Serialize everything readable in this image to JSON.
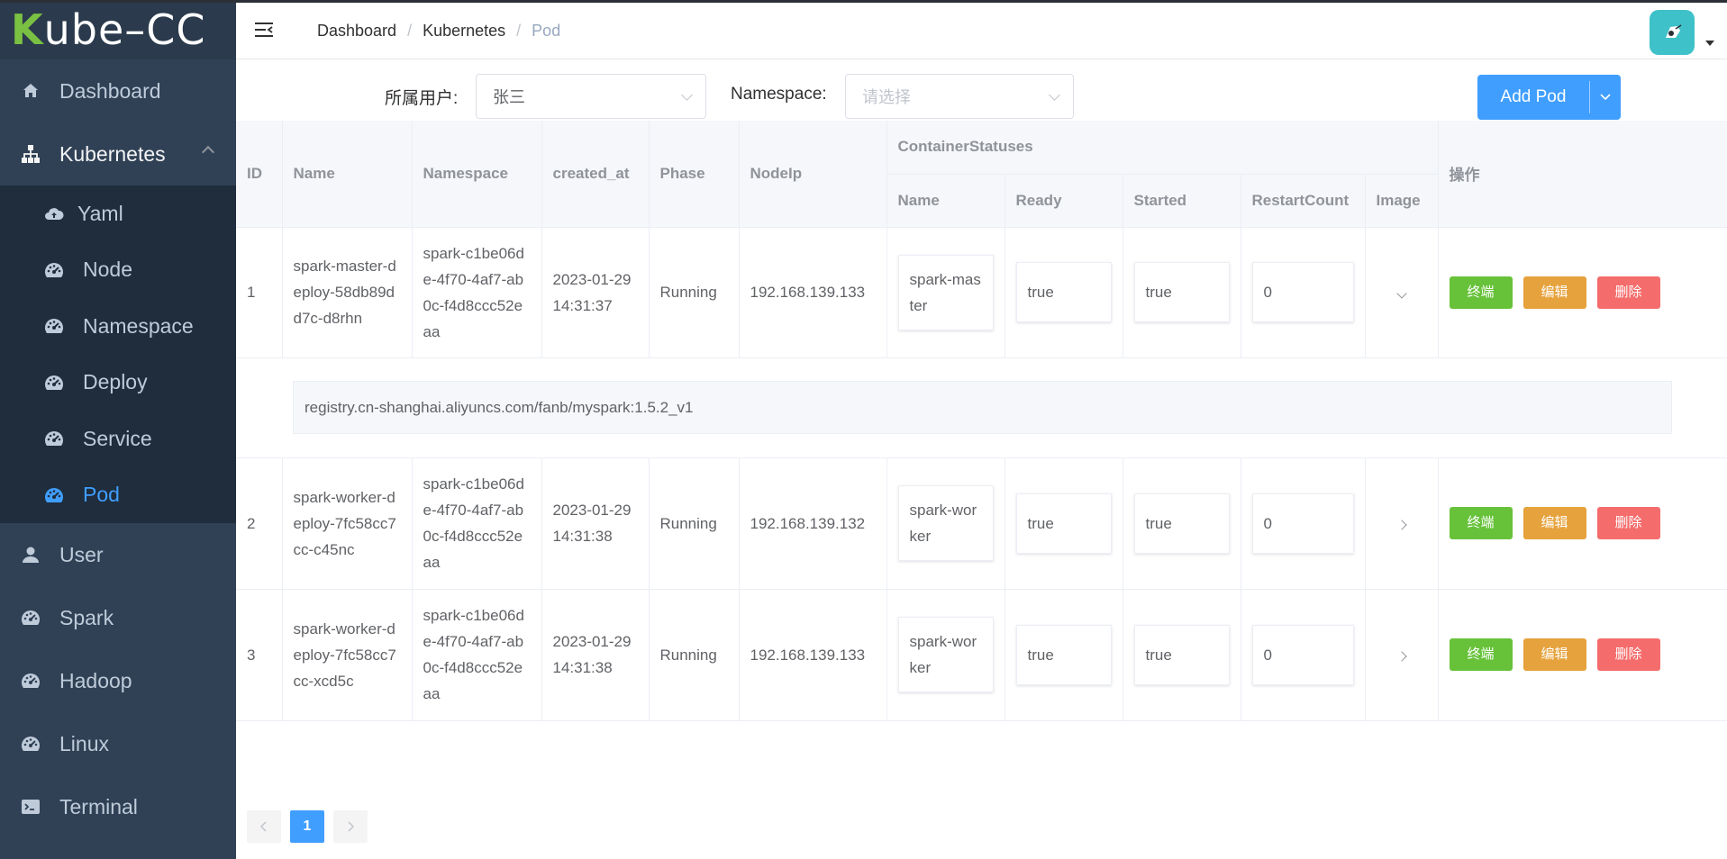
{
  "app": {
    "logo_text": "Kube-CC",
    "logo_letter": "K",
    "logo_rest": "ube–CC"
  },
  "sidebar": {
    "items": [
      {
        "label": "Dashboard",
        "icon": "home-icon"
      },
      {
        "label": "Kubernetes",
        "icon": "sitemap-icon"
      },
      {
        "label": "User",
        "icon": "user-icon"
      },
      {
        "label": "Spark",
        "icon": "dashboard-icon"
      },
      {
        "label": "Hadoop",
        "icon": "dashboard-icon"
      },
      {
        "label": "Linux",
        "icon": "dashboard-icon"
      },
      {
        "label": "Terminal",
        "icon": "terminal-icon"
      }
    ],
    "submenu": [
      {
        "label": "Yaml",
        "icon": "cloud-upload-icon"
      },
      {
        "label": "Node",
        "icon": "dashboard-icon"
      },
      {
        "label": "Namespace",
        "icon": "dashboard-icon"
      },
      {
        "label": "Deploy",
        "icon": "dashboard-icon"
      },
      {
        "label": "Service",
        "icon": "dashboard-icon"
      },
      {
        "label": "Pod",
        "icon": "dashboard-icon"
      }
    ],
    "active": "Pod",
    "active_color": "#409eff"
  },
  "header": {
    "breadcrumb": [
      "Dashboard",
      "Kubernetes",
      "Pod"
    ],
    "separator": "/"
  },
  "filter": {
    "user_label": "所属用户:",
    "user_value": "张三",
    "namespace_label": "Namespace:",
    "namespace_placeholder": "请选择",
    "add_button": "Add Pod"
  },
  "table": {
    "headers": {
      "id": "ID",
      "name": "Name",
      "namespace": "Namespace",
      "created_at": "created_at",
      "phase": "Phase",
      "nodeip": "NodeIp",
      "container_statuses": "ContainerStatuses",
      "c_name": "Name",
      "c_ready": "Ready",
      "c_started": "Started",
      "c_restart": "RestartCount",
      "c_image": "Image",
      "ops": "操作"
    },
    "rows": [
      {
        "id": "1",
        "name": "spark-master-deploy-58db89dd7c-d8rhn",
        "namespace": "spark-c1be06de-4f70-4af7-ab0c-f4d8ccc52eaa",
        "created_at": "2023-01-29 14:31:37",
        "phase": "Running",
        "nodeip": "192.168.139.133",
        "c_name": "spark-master",
        "c_ready": "true",
        "c_started": "true",
        "c_restart": "0",
        "expanded": true,
        "image": "registry.cn-shanghai.aliyuncs.com/fanb/myspark:1.5.2_v1"
      },
      {
        "id": "2",
        "name": "spark-worker-deploy-7fc58cc7cc-c45nc",
        "namespace": "spark-c1be06de-4f70-4af7-ab0c-f4d8ccc52eaa",
        "created_at": "2023-01-29 14:31:38",
        "phase": "Running",
        "nodeip": "192.168.139.132",
        "c_name": "spark-worker",
        "c_ready": "true",
        "c_started": "true",
        "c_restart": "0",
        "expanded": false
      },
      {
        "id": "3",
        "name": "spark-worker-deploy-7fc58cc7cc-xcd5c",
        "namespace": "spark-c1be06de-4f70-4af7-ab0c-f4d8ccc52eaa",
        "created_at": "2023-01-29 14:31:38",
        "phase": "Running",
        "nodeip": "192.168.139.133",
        "c_name": "spark-worker",
        "c_ready": "true",
        "c_started": "true",
        "c_restart": "0",
        "expanded": false
      }
    ],
    "ops": {
      "terminate": "终端",
      "edit": "编辑",
      "delete": "删除"
    }
  },
  "pagination": {
    "current_page": "1"
  },
  "colors": {
    "primary": "#409eff",
    "success": "#67c23a",
    "warning": "#e6a23c",
    "danger": "#f56c6c",
    "sidebar_bg": "#304156",
    "submenu_bg": "#1f2d3d"
  }
}
